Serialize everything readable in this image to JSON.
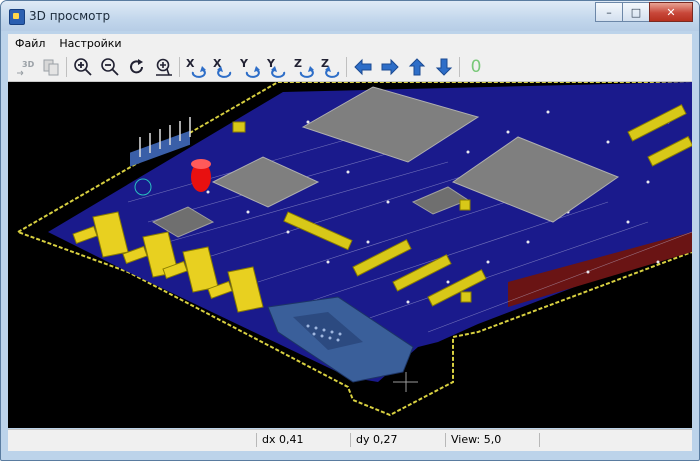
{
  "window": {
    "title": "3D просмотр"
  },
  "window_controls": {
    "minimize": "–",
    "maximize": "□",
    "close": "✕"
  },
  "menu": {
    "items": [
      "Файл",
      "Настройки"
    ]
  },
  "toolbar": {
    "buttons": [
      {
        "icon": "3d-view-icon",
        "label": "3D"
      },
      {
        "icon": "copy-icon"
      },
      {
        "icon": "zoom-in-icon"
      },
      {
        "icon": "zoom-out-icon"
      },
      {
        "icon": "redraw-icon"
      },
      {
        "icon": "zoom-fit-icon"
      },
      {
        "icon": "rotate-x-pos-icon",
        "label": "X"
      },
      {
        "icon": "rotate-x-neg-icon",
        "label": "X"
      },
      {
        "icon": "rotate-y-pos-icon",
        "label": "Y"
      },
      {
        "icon": "rotate-y-neg-icon",
        "label": "Y"
      },
      {
        "icon": "rotate-z-pos-icon",
        "label": "Z"
      },
      {
        "icon": "rotate-z-neg-icon",
        "label": "Z"
      },
      {
        "icon": "pan-left-icon"
      },
      {
        "icon": "pan-right-icon"
      },
      {
        "icon": "pan-up-icon"
      },
      {
        "icon": "pan-down-icon"
      },
      {
        "icon": "ortho-icon",
        "label": "0"
      }
    ]
  },
  "status": {
    "dx": "dx 0,41",
    "dy": "dy 0,27",
    "view": "View: 5,0"
  },
  "colors": {
    "board": "#1a1a8c",
    "board_edge": "#d8d040",
    "chip": "#7f7f7f",
    "connector": "#e8d020",
    "led": "#e81010",
    "db9": "#3a5f9a",
    "background": "#000000"
  }
}
